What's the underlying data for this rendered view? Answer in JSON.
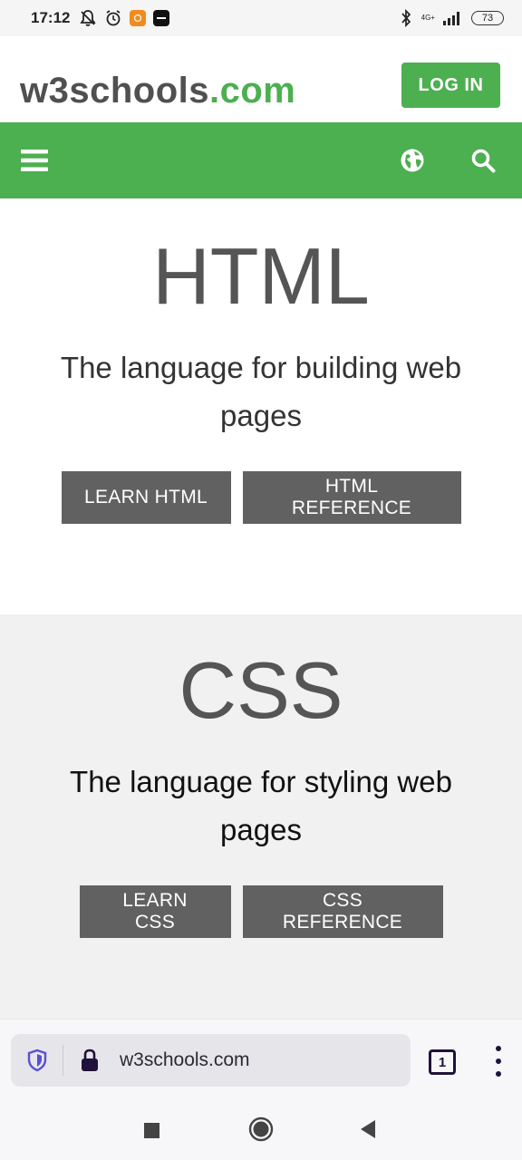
{
  "status_bar": {
    "time": "17:12",
    "network": "4G+",
    "battery": "73"
  },
  "header": {
    "logo_main": "w3schools",
    "logo_suffix": ".com",
    "login_label": "LOG IN"
  },
  "sections": [
    {
      "title": "HTML",
      "description": "The language for building web pages",
      "buttons": [
        "LEARN HTML",
        "HTML REFERENCE"
      ]
    },
    {
      "title": "CSS",
      "description": "The language for styling web pages",
      "buttons": [
        "LEARN CSS",
        "CSS REFERENCE"
      ]
    }
  ],
  "browser": {
    "url": "w3schools.com",
    "tab_count": "1"
  },
  "colors": {
    "brand_green": "#4caf50",
    "button_gray": "#616161",
    "title_gray": "#555555",
    "css_section_bg": "#f1f1f1"
  },
  "icons": {
    "nav_menu": "hamburger-icon",
    "nav_globe": "globe-icon",
    "nav_search": "search-icon",
    "url_shield": "shield-icon",
    "url_lock": "lock-icon",
    "android_recents": "square-icon",
    "android_home": "circle-icon",
    "android_back": "triangle-back-icon"
  }
}
